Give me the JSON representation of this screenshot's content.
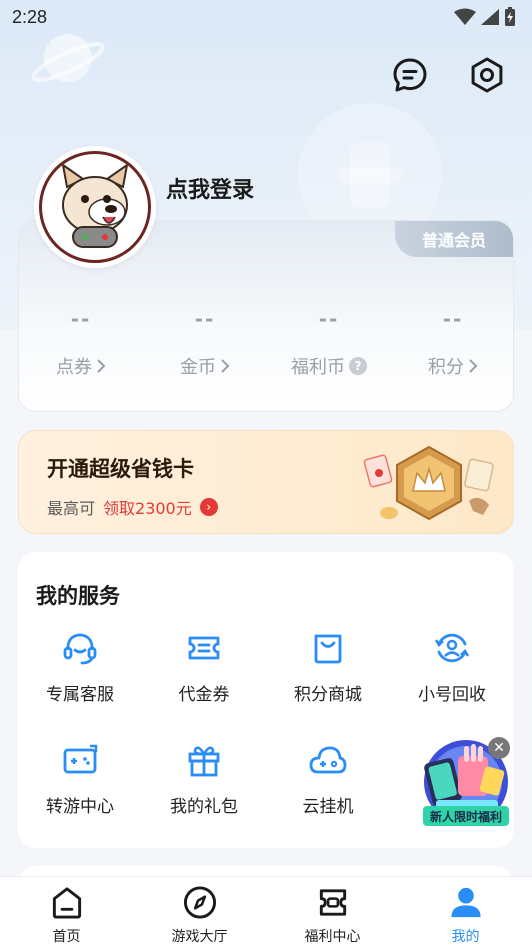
{
  "status_bar": {
    "time": "2:28"
  },
  "header": {
    "login_prompt": "点我登录"
  },
  "member": {
    "badge": "普通会员",
    "stats": [
      {
        "value": "--",
        "label": "点券"
      },
      {
        "value": "--",
        "label": "金币"
      },
      {
        "value": "--",
        "label": "福利币"
      },
      {
        "value": "--",
        "label": "积分"
      }
    ]
  },
  "saver_card": {
    "title": "开通超级省钱卡",
    "prefix": "最高可",
    "highlight": "领取2300元"
  },
  "services": {
    "title": "我的服务",
    "items": [
      {
        "label": "专属客服",
        "icon": "headset-icon"
      },
      {
        "label": "代金券",
        "icon": "voucher-icon"
      },
      {
        "label": "积分商城",
        "icon": "shopping-bag-icon"
      },
      {
        "label": "小号回收",
        "icon": "recycle-account-icon"
      },
      {
        "label": "转游中心",
        "icon": "game-transfer-icon"
      },
      {
        "label": "我的礼包",
        "icon": "gift-icon"
      },
      {
        "label": "云挂机",
        "icon": "cloud-gamepad-icon"
      }
    ]
  },
  "promo": {
    "label": "新人限时福利"
  },
  "tabs": [
    {
      "label": "首页",
      "icon": "home-icon"
    },
    {
      "label": "游戏大厅",
      "icon": "compass-icon"
    },
    {
      "label": "福利中心",
      "icon": "welfare-icon"
    },
    {
      "label": "我的",
      "icon": "profile-icon"
    }
  ],
  "colors": {
    "accent": "#2a8cf7",
    "highlight_red": "#e53935",
    "icon_blue": "#2a8cf7"
  }
}
